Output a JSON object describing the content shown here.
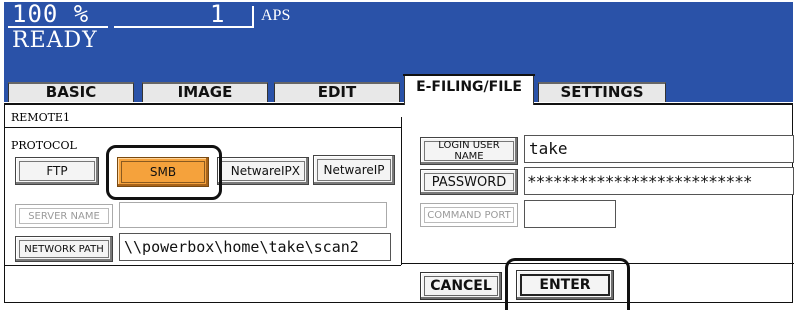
{
  "header": {
    "zoom": "100  %",
    "copies": "1",
    "paper_mode": "APS",
    "status": "READY",
    "bg_color": "#2a52a8"
  },
  "tabs": [
    {
      "label": "BASIC",
      "active": false
    },
    {
      "label": "IMAGE",
      "active": false
    },
    {
      "label": "EDIT",
      "active": false
    },
    {
      "label": "E-FILING/FILE",
      "active": true
    },
    {
      "label": "SETTINGS",
      "active": false
    }
  ],
  "panel": {
    "title": "REMOTE1",
    "protocol_label": "PROTOCOL",
    "protocols": [
      {
        "label": "FTP",
        "selected": false
      },
      {
        "label": "SMB",
        "selected": true
      },
      {
        "label": "NetwareIPX",
        "selected": false
      },
      {
        "label": "NetwareIP",
        "selected": false
      }
    ],
    "server_name": {
      "label": "SERVER NAME",
      "value": ""
    },
    "network_path": {
      "label": "NETWORK PATH",
      "value": "\\\\powerbox\\home\\take\\scan2"
    },
    "login_user_name": {
      "label": "LOGIN USER NAME",
      "value": "take"
    },
    "password": {
      "label": "PASSWORD",
      "value": "**************************"
    },
    "command_port": {
      "label": "COMMAND PORT",
      "value": ""
    }
  },
  "footer": {
    "cancel": "CANCEL",
    "enter": "ENTER"
  },
  "accent_color": "#f5a23c"
}
